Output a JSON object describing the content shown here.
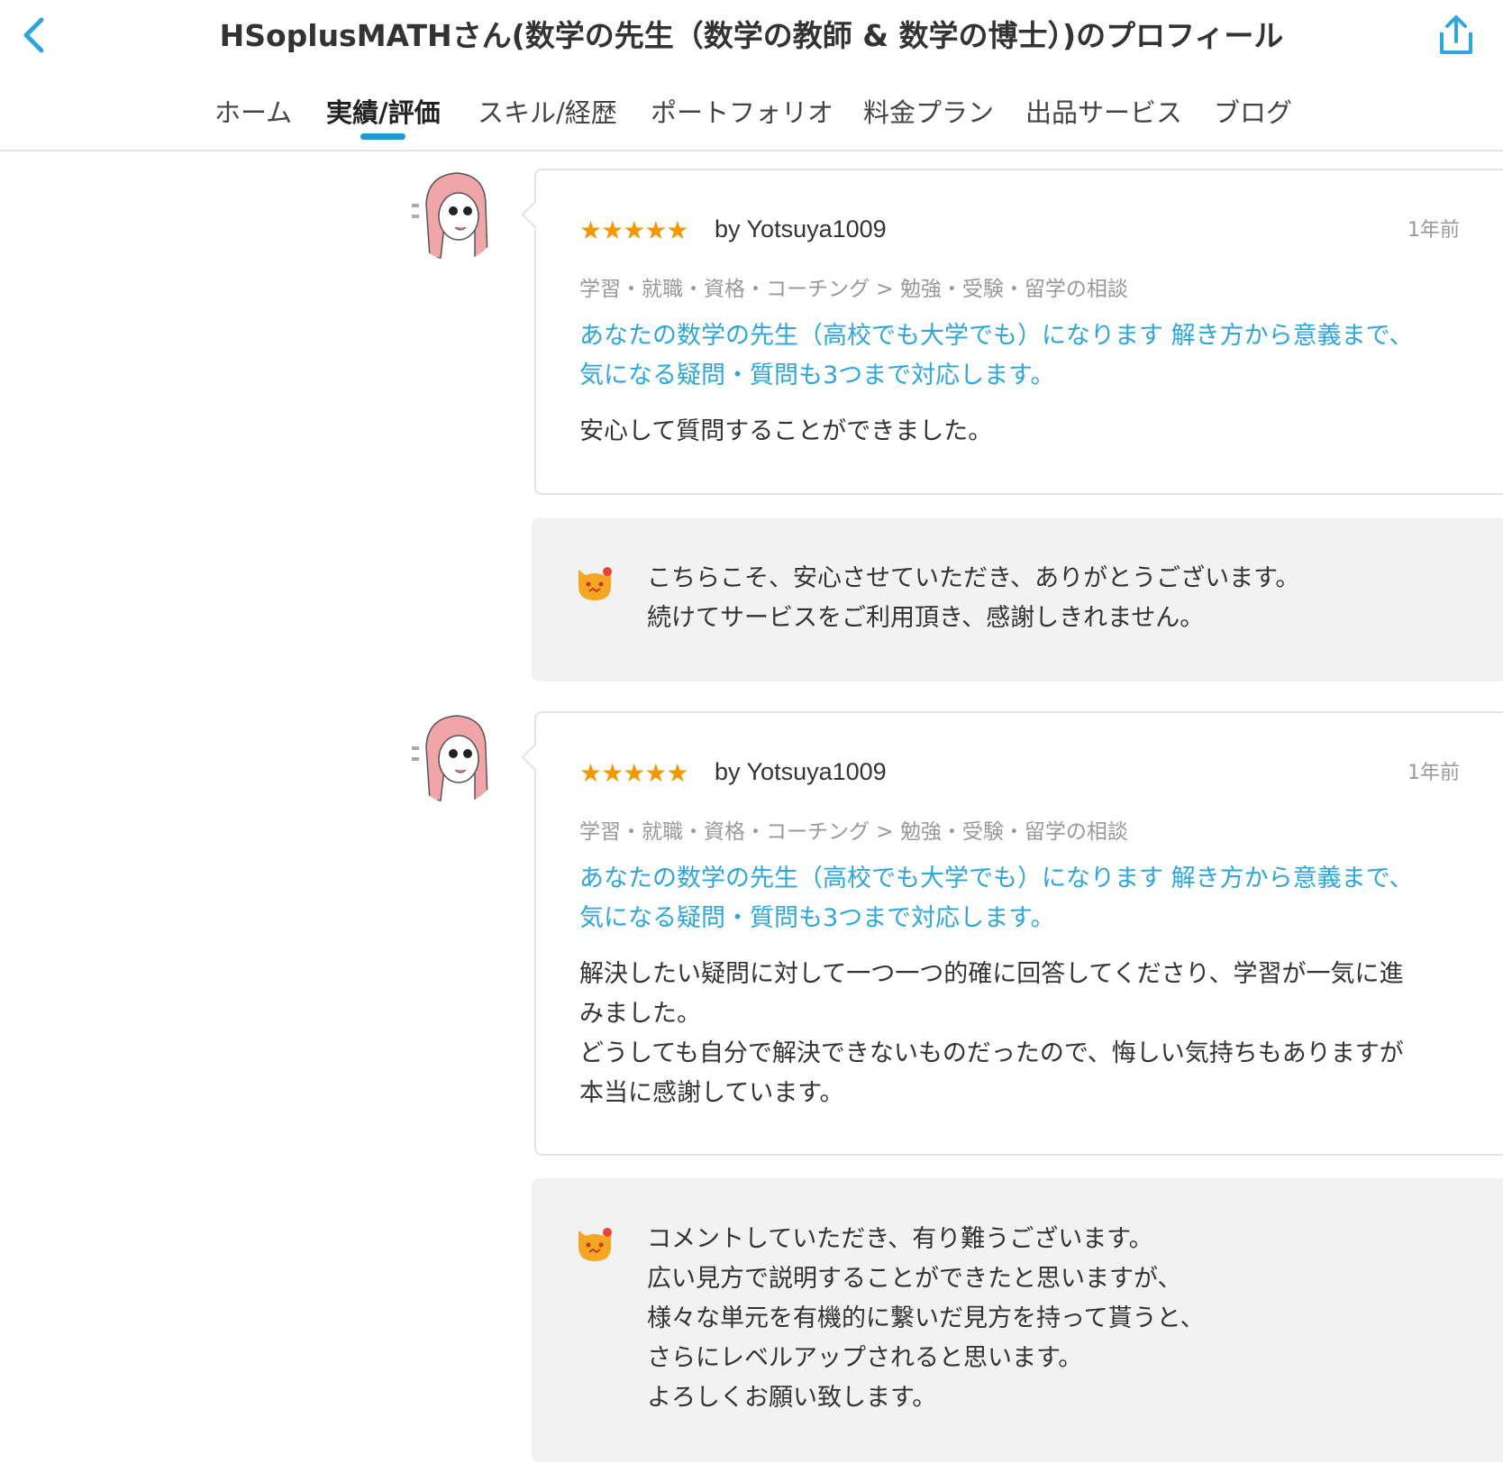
{
  "header": {
    "title": "HSoplusMATHさん(数学の先生（数学の教師 & 数学の博士）)のプロフィール",
    "back_icon": "chevron-left-icon",
    "share_icon": "share-icon",
    "accent_color": "#1e9bd7"
  },
  "tabs": {
    "items": [
      {
        "label": "ホーム"
      },
      {
        "label": "実績/評価"
      },
      {
        "label": "スキル/経歴"
      },
      {
        "label": "ポートフォリオ"
      },
      {
        "label": "料金プラン"
      },
      {
        "label": "出品サービス"
      },
      {
        "label": "ブログ"
      }
    ],
    "active": "実績/評価"
  },
  "reviews": [
    {
      "rating": 5,
      "stars": "★★★★★",
      "reviewer": "by Yotsuya1009",
      "time": "1年前",
      "category": "学習・就職・資格・コーチング > 勉強・受験・留学の相談",
      "service_lines": [
        "あなたの数学の先生（高校でも大学でも）になります 解き方から意義まで、",
        "気になる疑問・質問も3つまで対応します。"
      ],
      "comment_lines": [
        "安心して質問することができました。"
      ],
      "reply_lines": [
        "こちらこそ、安心させていただき、ありがとうございます。",
        "続けてサービスをご利用頂き、感謝しきれません。"
      ]
    },
    {
      "rating": 5,
      "stars": "★★★★★",
      "reviewer": "by Yotsuya1009",
      "time": "1年前",
      "category": "学習・就職・資格・コーチング > 勉強・受験・留学の相談",
      "service_lines": [
        "あなたの数学の先生（高校でも大学でも）になります 解き方から意義まで、",
        "気になる疑問・質問も3つまで対応します。"
      ],
      "comment_lines": [
        "解決したい疑問に対して一つ一つ的確に回答してくださり、学習が一気に進",
        "みました。",
        "どうしても自分で解決できないものだったので、悔しい気持ちもありますが",
        "本当に感謝しています。"
      ],
      "reply_lines": [
        "コメントしていただき、有り難うございます。",
        "広い見方で説明することができたと思いますが、",
        "様々な単元を有機的に繋いだ見方を持って貰うと、",
        "さらにレベルアップされると思います。",
        "よろしくお願い致します。"
      ]
    }
  ],
  "colors": {
    "star": "#f39800",
    "link": "#2ea6dc",
    "muted": "#999999",
    "reply_bg": "#f2f2f2",
    "avatar_hair": "#f0a6a8",
    "seller_icon": "#f5a623"
  }
}
